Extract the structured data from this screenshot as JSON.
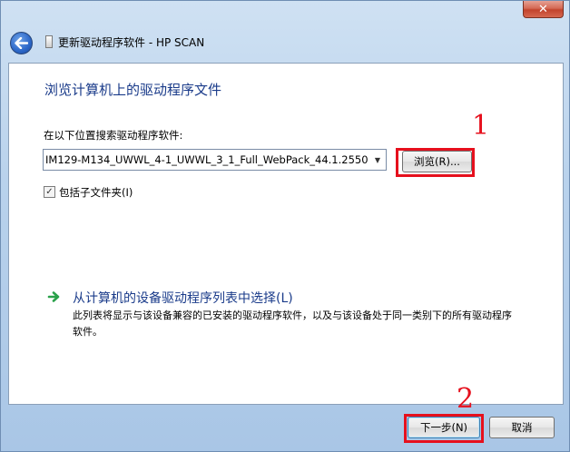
{
  "window": {
    "title": "更新驱动程序软件 - HP SCAN",
    "close_label": "✕"
  },
  "page": {
    "heading": "浏览计算机上的驱动程序文件",
    "search_label": "在以下位置搜索驱动程序软件:",
    "path_value": "IM129-M134_UWWL_4-1_UWWL_3_1_Full_WebPack_44.1.2550",
    "browse_label": "浏览(R)...",
    "include_subfolders_label": "包括子文件夹(I)",
    "include_subfolders_checked": true,
    "pick_link": "从计算机的设备驱动程序列表中选择(L)",
    "pick_desc": "此列表将显示与该设备兼容的已安装的驱动程序软件，以及与该设备处于同一类别下的所有驱动程序软件。"
  },
  "footer": {
    "next_label": "下一步(N)",
    "cancel_label": "取消"
  },
  "annotations": {
    "step1": "1",
    "step2": "2",
    "color": "#e6101d"
  }
}
